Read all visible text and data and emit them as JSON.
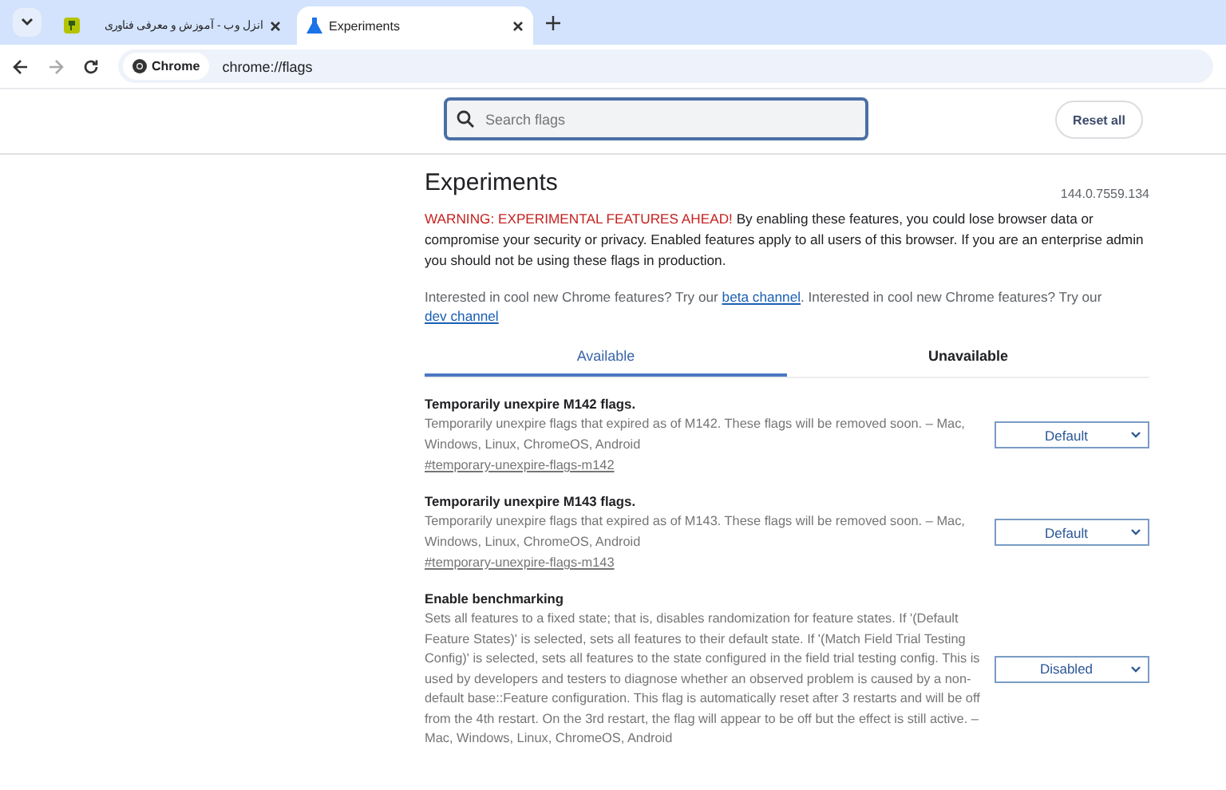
{
  "browser_tabs": [
    {
      "title": "انزل وب - آموزش و معرفی فناوری",
      "selected": false
    },
    {
      "title": "Experiments",
      "selected": true
    }
  ],
  "toolbar": {
    "site_chip": "Chrome",
    "address": "chrome://flags"
  },
  "header": {
    "search": {
      "placeholder": "Search flags"
    },
    "reset_button": "Reset all"
  },
  "page": {
    "title": "Experiments",
    "version": "144.0.7559.134",
    "warning": {
      "label": "WARNING: EXPERIMENTAL FEATURES AHEAD!",
      "text": "By enabling these features, you could lose browser data or compromise your security or privacy. Enabled features apply to all users of this browser. If you are an enterprise admin you should not be using these flags in production."
    },
    "intro": [
      {
        "kind": "text",
        "text": "Interested in cool new Chrome features? Try our "
      },
      {
        "kind": "link",
        "text": "beta channel"
      },
      {
        "kind": "text",
        "text": ". Interested in cool new Chrome features? Try our "
      },
      {
        "kind": "link",
        "text": "dev channel"
      }
    ],
    "tabs": [
      {
        "label": "Available",
        "selected": true
      },
      {
        "label": "Unavailable",
        "selected": false
      }
    ],
    "flags": [
      {
        "title": "Temporarily unexpire M142 flags.",
        "description": "Temporarily unexpire flags that expired as of M142. These flags will be removed soon. – Mac, Windows, Linux, ChromeOS, Android",
        "link": "#temporary-unexpire-flags-m142",
        "value": "Default"
      },
      {
        "title": "Temporarily unexpire M143 flags.",
        "description": "Temporarily unexpire flags that expired as of M143. These flags will be removed soon. – Mac, Windows, Linux, ChromeOS, Android",
        "link": "#temporary-unexpire-flags-m143",
        "value": "Default"
      },
      {
        "title": "Enable benchmarking",
        "description": "Sets all features to a fixed state; that is, disables randomization for feature states. If '(Default Feature States)' is selected, sets all features to their default state. If '(Match Field Trial Testing Config)' is selected, sets all features to the state configured in the field trial testing config. This is used by developers and testers to diagnose whether an observed problem is caused by a non-default base::Feature configuration. This flag is automatically reset after 3 restarts and will be off from the 4th restart. On the 3rd restart, the flag will appear to be off but the effect is still active. – Mac, Windows, Linux, ChromeOS, Android",
        "value": "Disabled"
      }
    ]
  }
}
